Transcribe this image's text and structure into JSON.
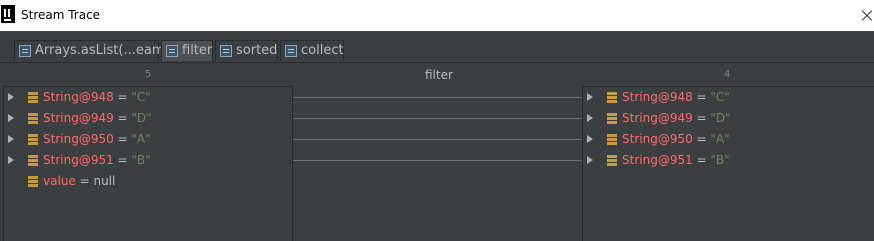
{
  "window": {
    "title": "Stream Trace"
  },
  "tabs": [
    {
      "label": "Arrays.asList(...eam()"
    },
    {
      "label": "filter"
    },
    {
      "label": "sorted"
    },
    {
      "label": "collect"
    }
  ],
  "header": {
    "left_count": "5",
    "operation": "filter",
    "right_count": "4"
  },
  "left_items": [
    {
      "name": "String@948",
      "eq": " = ",
      "value": "\"C\""
    },
    {
      "name": "String@949",
      "eq": " = ",
      "value": "\"D\""
    },
    {
      "name": "String@950",
      "eq": " = ",
      "value": "\"A\""
    },
    {
      "name": "String@951",
      "eq": " = ",
      "value": "\"B\""
    },
    {
      "name": "value",
      "eq": " = ",
      "value": "null"
    }
  ],
  "right_items": [
    {
      "name": "String@948",
      "eq": " = ",
      "value": "\"C\""
    },
    {
      "name": "String@949",
      "eq": " = ",
      "value": "\"D\""
    },
    {
      "name": "String@950",
      "eq": " = ",
      "value": "\"A\""
    },
    {
      "name": "String@951",
      "eq": " = ",
      "value": "\"B\""
    }
  ],
  "colors": {
    "name": "#ff6b68",
    "string_value": "#6a8759",
    "background": "#3c3f41",
    "field_icon": "#c79a3c"
  }
}
